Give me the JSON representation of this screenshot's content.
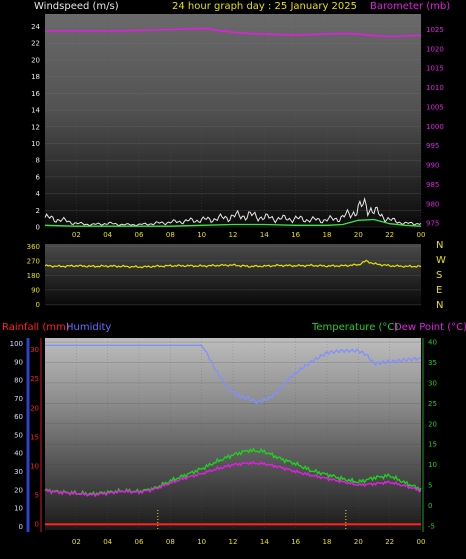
{
  "header": {
    "windspeed_label": "Windspeed (m/s)",
    "title": "24 hour graph day : 25 January 2025",
    "barometer_label": "Barometer (mb)",
    "rainfall_label": "Rainfall (mm)",
    "humidity_label": "Humidity",
    "temperature_label": "Temperature (°C)",
    "dewpoint_label": "Dew Point (°C)"
  },
  "colors": {
    "windspeed": "#e8e8e8",
    "wind_avg": "#40e040",
    "barometer": "#e020e0",
    "direction": "#e8e000",
    "rain": "#ff2020",
    "humidity": "#8090ff",
    "temperature": "#20d020",
    "dewpoint": "#e020e0",
    "ticks": "#e8e000",
    "axis": "#3040c8"
  },
  "chart_data": [
    {
      "type": "line",
      "title": "24 hour graph day : 25 January 2025",
      "xlabel": "",
      "x_ticks": [
        "02",
        "04",
        "06",
        "08",
        "10",
        "12",
        "14",
        "16",
        "18",
        "20",
        "22",
        "00"
      ],
      "y_left_label": "Windspeed (m/s)",
      "y_left_ticks": [
        0,
        2,
        4,
        6,
        8,
        10,
        12,
        14,
        16,
        18,
        20,
        22,
        24
      ],
      "ylim_left": [
        0,
        25.5
      ],
      "y_right_label": "Barometer (mb)",
      "y_right_ticks": [
        975,
        980,
        985,
        990,
        995,
        1000,
        1005,
        1010,
        1015,
        1020,
        1025
      ],
      "ylim_right": [
        974,
        1029
      ],
      "series": [
        {
          "name": "Barometer (mb)",
          "axis": "right",
          "x": [
            0,
            2,
            4,
            6,
            8,
            9,
            10,
            10.5,
            11,
            12,
            13,
            14,
            16,
            18,
            19,
            20,
            21,
            22,
            23,
            24
          ],
          "values": [
            1024.6,
            1024.7,
            1024.6,
            1024.8,
            1025.0,
            1025.1,
            1025.3,
            1025.1,
            1024.8,
            1024.3,
            1024.0,
            1023.8,
            1023.6,
            1023.8,
            1024.0,
            1023.8,
            1023.4,
            1023.2,
            1023.3,
            1023.5
          ]
        },
        {
          "name": "Windspeed (m/s)",
          "axis": "left",
          "x": [
            0,
            1,
            2,
            3,
            4,
            5,
            6,
            7,
            8,
            9,
            10,
            11,
            12,
            13,
            14,
            15,
            16,
            17,
            18,
            19,
            20,
            20.5,
            21,
            22,
            23,
            24
          ],
          "values": [
            0.8,
            0.6,
            0.3,
            0.2,
            0.3,
            0.2,
            0.2,
            0.3,
            0.4,
            0.5,
            0.6,
            0.7,
            0.9,
            1.0,
            0.8,
            0.7,
            0.7,
            0.6,
            0.6,
            0.8,
            1.5,
            1.9,
            1.3,
            0.6,
            0.3,
            0.3
          ]
        },
        {
          "name": "",
          "axis": "left",
          "x": [
            0,
            2,
            4,
            6,
            8,
            10,
            12,
            14,
            16,
            18,
            19,
            20,
            21,
            22,
            23,
            24
          ],
          "values": [
            0.2,
            0.1,
            0.1,
            0.1,
            0.1,
            0.2,
            0.3,
            0.3,
            0.2,
            0.2,
            0.3,
            0.8,
            0.9,
            0.4,
            0.2,
            0.1
          ]
        }
      ]
    },
    {
      "type": "line",
      "y_ticks": [
        0,
        90,
        180,
        270,
        360
      ],
      "ylim": [
        -10,
        375
      ],
      "direction_labels": [
        "N",
        "W",
        "S",
        "E",
        "N"
      ],
      "series": [
        {
          "name": "",
          "x": [
            0,
            1,
            2,
            3,
            4,
            5,
            6,
            7,
            8,
            9,
            10,
            11,
            12,
            13,
            14,
            15,
            16,
            17,
            18,
            19,
            20,
            20.5,
            21,
            22,
            23,
            24
          ],
          "values": [
            240,
            236,
            240,
            236,
            238,
            236,
            232,
            236,
            240,
            240,
            238,
            242,
            244,
            236,
            238,
            242,
            240,
            242,
            238,
            240,
            246,
            270,
            252,
            240,
            236,
            236
          ]
        }
      ]
    },
    {
      "type": "line",
      "x_ticks": [
        "02",
        "04",
        "06",
        "08",
        "10",
        "12",
        "14",
        "16",
        "18",
        "20",
        "22",
        "00"
      ],
      "y_far_left_ticks": [
        0,
        10,
        20,
        30,
        40,
        50,
        60,
        70,
        80,
        90,
        100
      ],
      "ylim_humidity": [
        -2,
        103
      ],
      "y_left_label": "Rainfall (mm)",
      "y_left_ticks": [
        0,
        5,
        10,
        15,
        20,
        25,
        30
      ],
      "ylim_rain": [
        -1,
        32
      ],
      "y_right_label": "Temperature (°C)",
      "y_right_ticks": [
        -5,
        0,
        5,
        10,
        15,
        20,
        25,
        30,
        35,
        40
      ],
      "ylim_right": [
        -6,
        41
      ],
      "series": [
        {
          "name": "Humidity",
          "axis": "humidity",
          "x": [
            0,
            2,
            4,
            6,
            8,
            9,
            10,
            10.5,
            11,
            11.5,
            12,
            12.5,
            13,
            13.5,
            14,
            14.5,
            15,
            15.5,
            16,
            17,
            18,
            19,
            20,
            20.5,
            21,
            22,
            23,
            24
          ],
          "values": [
            99,
            99,
            99,
            99,
            99,
            99,
            99,
            92,
            84,
            78,
            73,
            71,
            70,
            68,
            69,
            71,
            75,
            80,
            84,
            90,
            95,
            96,
            96,
            94,
            89,
            90,
            91,
            92
          ]
        },
        {
          "name": "Temperature (°C)",
          "axis": "right",
          "x": [
            0,
            1,
            2,
            3,
            4,
            5,
            6,
            7,
            8,
            9,
            10,
            11,
            12,
            13,
            14,
            15,
            16,
            17,
            18,
            19,
            20,
            21,
            22,
            23,
            24
          ],
          "values": [
            3.7,
            3.3,
            3.0,
            2.8,
            3.2,
            3.6,
            3.4,
            4.2,
            6.0,
            7.5,
            9.0,
            10.8,
            12.4,
            13.5,
            13.2,
            11.5,
            10.2,
            8.5,
            7.6,
            6.5,
            5.7,
            6.8,
            7.3,
            5.5,
            4.0
          ]
        },
        {
          "name": "Dew Point (°C)",
          "axis": "right",
          "x": [
            0,
            1,
            2,
            3,
            4,
            5,
            6,
            7,
            8,
            9,
            10,
            11,
            12,
            13,
            14,
            15,
            16,
            17,
            18,
            19,
            20,
            21,
            22,
            23,
            24
          ],
          "values": [
            3.6,
            3.2,
            2.9,
            2.6,
            3.0,
            3.5,
            3.2,
            4.0,
            5.5,
            6.8,
            7.8,
            9.0,
            10.0,
            10.4,
            10.2,
            9.4,
            8.3,
            7.4,
            6.6,
            5.8,
            5.0,
            5.3,
            5.7,
            4.8,
            3.6
          ]
        },
        {
          "name": "Rainfall (mm)",
          "axis": "rain",
          "x": [
            0,
            24
          ],
          "values": [
            0,
            0
          ]
        }
      ],
      "markers_x": [
        7.2,
        19.2
      ]
    }
  ]
}
